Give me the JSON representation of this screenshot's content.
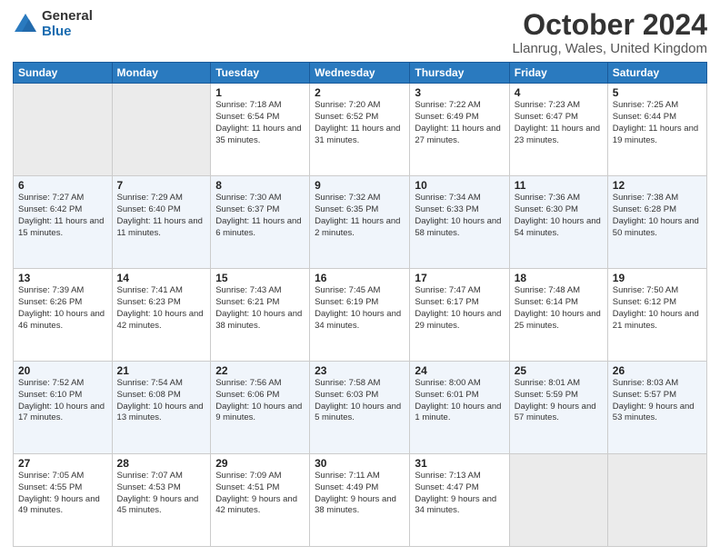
{
  "logo": {
    "general": "General",
    "blue": "Blue"
  },
  "title": {
    "month": "October 2024",
    "location": "Llanrug, Wales, United Kingdom"
  },
  "days_header": [
    "Sunday",
    "Monday",
    "Tuesday",
    "Wednesday",
    "Thursday",
    "Friday",
    "Saturday"
  ],
  "weeks": [
    [
      {
        "day": "",
        "info": ""
      },
      {
        "day": "",
        "info": ""
      },
      {
        "day": "1",
        "info": "Sunrise: 7:18 AM\nSunset: 6:54 PM\nDaylight: 11 hours and 35 minutes."
      },
      {
        "day": "2",
        "info": "Sunrise: 7:20 AM\nSunset: 6:52 PM\nDaylight: 11 hours and 31 minutes."
      },
      {
        "day": "3",
        "info": "Sunrise: 7:22 AM\nSunset: 6:49 PM\nDaylight: 11 hours and 27 minutes."
      },
      {
        "day": "4",
        "info": "Sunrise: 7:23 AM\nSunset: 6:47 PM\nDaylight: 11 hours and 23 minutes."
      },
      {
        "day": "5",
        "info": "Sunrise: 7:25 AM\nSunset: 6:44 PM\nDaylight: 11 hours and 19 minutes."
      }
    ],
    [
      {
        "day": "6",
        "info": "Sunrise: 7:27 AM\nSunset: 6:42 PM\nDaylight: 11 hours and 15 minutes."
      },
      {
        "day": "7",
        "info": "Sunrise: 7:29 AM\nSunset: 6:40 PM\nDaylight: 11 hours and 11 minutes."
      },
      {
        "day": "8",
        "info": "Sunrise: 7:30 AM\nSunset: 6:37 PM\nDaylight: 11 hours and 6 minutes."
      },
      {
        "day": "9",
        "info": "Sunrise: 7:32 AM\nSunset: 6:35 PM\nDaylight: 11 hours and 2 minutes."
      },
      {
        "day": "10",
        "info": "Sunrise: 7:34 AM\nSunset: 6:33 PM\nDaylight: 10 hours and 58 minutes."
      },
      {
        "day": "11",
        "info": "Sunrise: 7:36 AM\nSunset: 6:30 PM\nDaylight: 10 hours and 54 minutes."
      },
      {
        "day": "12",
        "info": "Sunrise: 7:38 AM\nSunset: 6:28 PM\nDaylight: 10 hours and 50 minutes."
      }
    ],
    [
      {
        "day": "13",
        "info": "Sunrise: 7:39 AM\nSunset: 6:26 PM\nDaylight: 10 hours and 46 minutes."
      },
      {
        "day": "14",
        "info": "Sunrise: 7:41 AM\nSunset: 6:23 PM\nDaylight: 10 hours and 42 minutes."
      },
      {
        "day": "15",
        "info": "Sunrise: 7:43 AM\nSunset: 6:21 PM\nDaylight: 10 hours and 38 minutes."
      },
      {
        "day": "16",
        "info": "Sunrise: 7:45 AM\nSunset: 6:19 PM\nDaylight: 10 hours and 34 minutes."
      },
      {
        "day": "17",
        "info": "Sunrise: 7:47 AM\nSunset: 6:17 PM\nDaylight: 10 hours and 29 minutes."
      },
      {
        "day": "18",
        "info": "Sunrise: 7:48 AM\nSunset: 6:14 PM\nDaylight: 10 hours and 25 minutes."
      },
      {
        "day": "19",
        "info": "Sunrise: 7:50 AM\nSunset: 6:12 PM\nDaylight: 10 hours and 21 minutes."
      }
    ],
    [
      {
        "day": "20",
        "info": "Sunrise: 7:52 AM\nSunset: 6:10 PM\nDaylight: 10 hours and 17 minutes."
      },
      {
        "day": "21",
        "info": "Sunrise: 7:54 AM\nSunset: 6:08 PM\nDaylight: 10 hours and 13 minutes."
      },
      {
        "day": "22",
        "info": "Sunrise: 7:56 AM\nSunset: 6:06 PM\nDaylight: 10 hours and 9 minutes."
      },
      {
        "day": "23",
        "info": "Sunrise: 7:58 AM\nSunset: 6:03 PM\nDaylight: 10 hours and 5 minutes."
      },
      {
        "day": "24",
        "info": "Sunrise: 8:00 AM\nSunset: 6:01 PM\nDaylight: 10 hours and 1 minute."
      },
      {
        "day": "25",
        "info": "Sunrise: 8:01 AM\nSunset: 5:59 PM\nDaylight: 9 hours and 57 minutes."
      },
      {
        "day": "26",
        "info": "Sunrise: 8:03 AM\nSunset: 5:57 PM\nDaylight: 9 hours and 53 minutes."
      }
    ],
    [
      {
        "day": "27",
        "info": "Sunrise: 7:05 AM\nSunset: 4:55 PM\nDaylight: 9 hours and 49 minutes."
      },
      {
        "day": "28",
        "info": "Sunrise: 7:07 AM\nSunset: 4:53 PM\nDaylight: 9 hours and 45 minutes."
      },
      {
        "day": "29",
        "info": "Sunrise: 7:09 AM\nSunset: 4:51 PM\nDaylight: 9 hours and 42 minutes."
      },
      {
        "day": "30",
        "info": "Sunrise: 7:11 AM\nSunset: 4:49 PM\nDaylight: 9 hours and 38 minutes."
      },
      {
        "day": "31",
        "info": "Sunrise: 7:13 AM\nSunset: 4:47 PM\nDaylight: 9 hours and 34 minutes."
      },
      {
        "day": "",
        "info": ""
      },
      {
        "day": "",
        "info": ""
      }
    ]
  ]
}
